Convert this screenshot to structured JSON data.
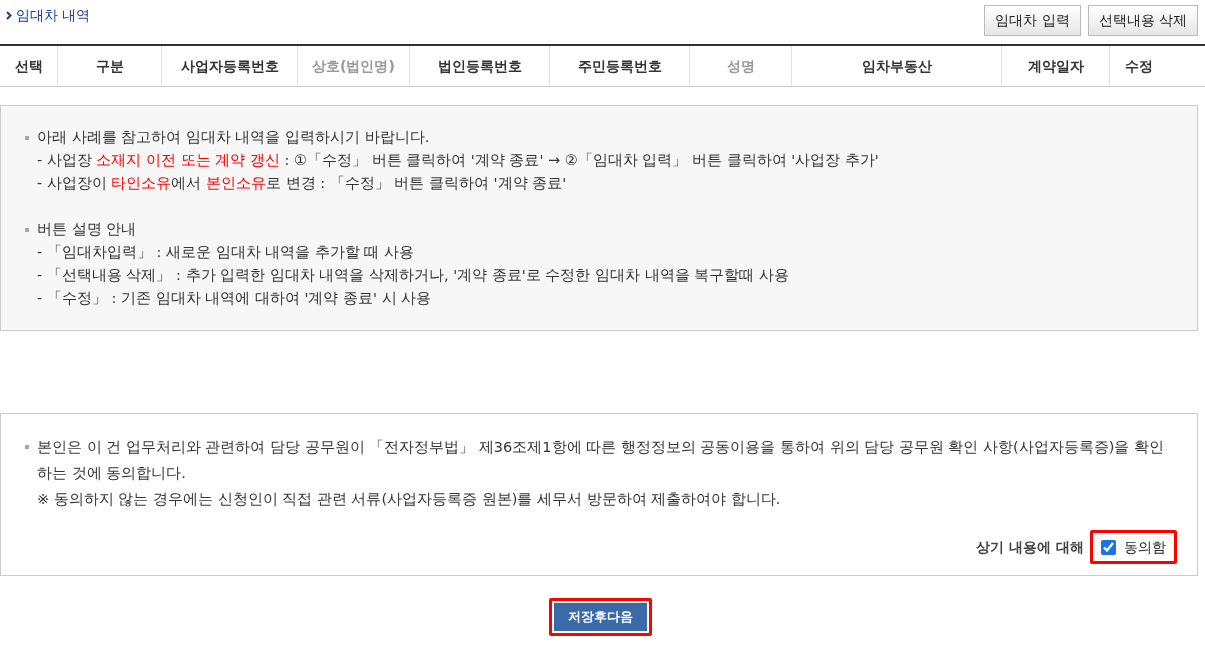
{
  "section_title": "임대차 내역",
  "buttons": [
    {
      "label": "임대차 입력"
    },
    {
      "label": "선택내용 삭제"
    }
  ],
  "table": {
    "columns": [
      {
        "label": "선택",
        "muted": false
      },
      {
        "label": "구분",
        "muted": false
      },
      {
        "label": "사업자등록번호",
        "muted": false
      },
      {
        "label": "상호(법인명)",
        "muted": true
      },
      {
        "label": "법인등록번호",
        "muted": false
      },
      {
        "label": "주민등록번호",
        "muted": false
      },
      {
        "label": "성명",
        "muted": true
      },
      {
        "label": "임차부동산",
        "muted": false
      },
      {
        "label": "계약일자",
        "muted": false
      },
      {
        "label": "수정",
        "muted": false
      }
    ]
  },
  "guide": {
    "groups": [
      {
        "heading": "아래 사례를 참고하여 임대차 내역을 입력하시기 바랍니다.",
        "lines": [
          [
            {
              "text": "- 사업장 ",
              "highlight": false
            },
            {
              "text": "소재지 이전 또는 계약 갱신",
              "highlight": true
            },
            {
              "text": " : ①「수정」 버튼 클릭하여 '계약 종료' → ②「임대차 입력」 버튼 클릭하여 '사업장 추가'",
              "highlight": false
            }
          ],
          [
            {
              "text": "- 사업장이 ",
              "highlight": false
            },
            {
              "text": "타인소유",
              "highlight": true
            },
            {
              "text": "에서 ",
              "highlight": false
            },
            {
              "text": "본인소유",
              "highlight": true
            },
            {
              "text": "로 변경 : 「수정」 버튼 클릭하여 '계약 종료'",
              "highlight": false
            }
          ]
        ]
      },
      {
        "heading": "버튼 설명 안내",
        "lines": [
          [
            {
              "text": "- 「임대차입력」 : 새로운 임대차 내역을 추가할 때 사용",
              "highlight": false
            }
          ],
          [
            {
              "text": "- 「선택내용 삭제」 : 추가 입력한 임대차 내역을 삭제하거나, '계약 종료'로 수정한 임대차 내역을 복구할때 사용",
              "highlight": false
            }
          ],
          [
            {
              "text": "- 「수정」 : 기존 임대차 내역에 대하여 '계약 종료' 시 사용",
              "highlight": false
            }
          ]
        ]
      }
    ]
  },
  "consent": {
    "statement": "본인은 이 건 업무처리와 관련하여 담당 공무원이 「전자정부법」 제36조제1항에 따른 행정정보의 공동이용을 통하여 위의 담당 공무원 확인 사항(사업자등록증)을 확인하는 것에 동의합니다.",
    "note": "※  동의하지 않는 경우에는 신청인이 직접 관련 서류(사업자등록증 원본)를 세무서 방문하여 제출하여야 합니다.",
    "prompt": "상기 내용에 대해",
    "checkbox": {
      "label": "동의함",
      "checked": true
    }
  },
  "submit": {
    "label": "저장후다음"
  }
}
